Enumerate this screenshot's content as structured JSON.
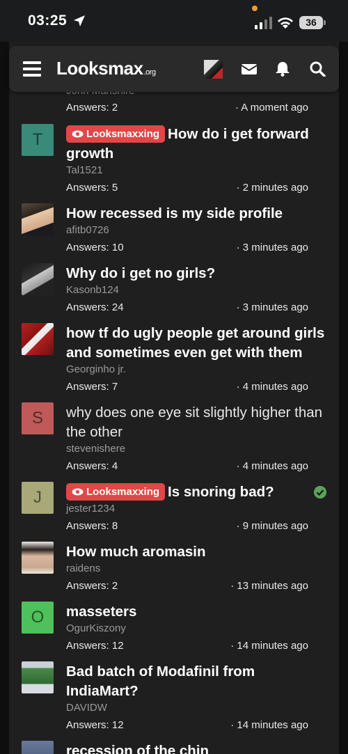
{
  "status_bar": {
    "time": "03:25",
    "battery": "36"
  },
  "navbar": {
    "logo_main": "Looksmax",
    "logo_suffix": ".org"
  },
  "partial_top": {
    "answers": "Answers: 2",
    "time": "· A moment ago",
    "author": "John Manshire",
    "prev_answers": "Answers: 2",
    "prev_time": "A moment ago"
  },
  "threads": [
    {
      "avatar_letter": "T",
      "avatar_color": "#3a8a7a",
      "tag": "Looksmaxxing",
      "title": "How do i get forward growth",
      "author": "Tal1521",
      "answers": "Answers: 5",
      "time": "· 2 minutes ago"
    },
    {
      "avatar_letter": "",
      "avatar_color": "#2a3a4a",
      "tag": "",
      "title": "How recessed is my side profile",
      "author": "afitb0726",
      "answers": "Answers: 10",
      "time": "· 3 minutes ago"
    },
    {
      "avatar_letter": "",
      "avatar_color": "#3b3b3b",
      "tag": "",
      "title": "Why do i get no girls?",
      "author": "Kasonb124",
      "answers": "Answers: 24",
      "time": "· 3 minutes ago"
    },
    {
      "avatar_letter": "",
      "avatar_color": "#8a1f1f",
      "tag": "",
      "title": "how tf do ugly people get around girls and sometimes even get with them",
      "author": "Georginho jr.",
      "answers": "Answers: 7",
      "time": "· 4 minutes ago"
    },
    {
      "avatar_letter": "S",
      "avatar_color": "#c05a5a",
      "tag": "",
      "title": "why does one eye sit slightly higher than the other",
      "author": "stevenishere",
      "answers": "Answers: 4",
      "time": "· 4 minutes ago"
    },
    {
      "avatar_letter": "J",
      "avatar_color": "#a8a878",
      "tag": "Looksmaxxing",
      "title": "Is snoring bad?",
      "author": "jester1234",
      "answers": "Answers: 8",
      "time": "· 9 minutes ago"
    },
    {
      "avatar_letter": "",
      "avatar_color": "#d8d0c8",
      "tag": "",
      "title": "How much aromasin",
      "author": "raidens",
      "answers": "Answers: 2",
      "time": "· 13 minutes ago"
    },
    {
      "avatar_letter": "O",
      "avatar_color": "#4ec15a",
      "tag": "",
      "title": "masseters",
      "author": "OgurKiszony",
      "answers": "Answers: 12",
      "time": "· 14 minutes ago"
    },
    {
      "avatar_letter": "",
      "avatar_color": "#5a8a5a",
      "tag": "",
      "title": "Bad batch of Modafinil from IndiaMart?",
      "author": "DAVIDW",
      "answers": "Answers: 12",
      "time": "· 14 minutes ago"
    },
    {
      "avatar_letter": "",
      "avatar_color": "#4a5a7a",
      "tag": "",
      "title": "recession of the chin",
      "author": "",
      "answers": "",
      "time": ""
    }
  ],
  "icons": {
    "location": "location-arrow-icon",
    "signal": "cellular-signal-icon",
    "wifi": "wifi-icon",
    "menu": "hamburger-menu-icon",
    "inbox": "envelope-icon",
    "alerts": "bell-icon",
    "search": "search-icon",
    "tag": "eye-icon",
    "solved": "checkmark-icon"
  },
  "colors": {
    "tag_red": "#e14747",
    "solved_green": "#5ba35b",
    "panel": "#1f1f20"
  }
}
